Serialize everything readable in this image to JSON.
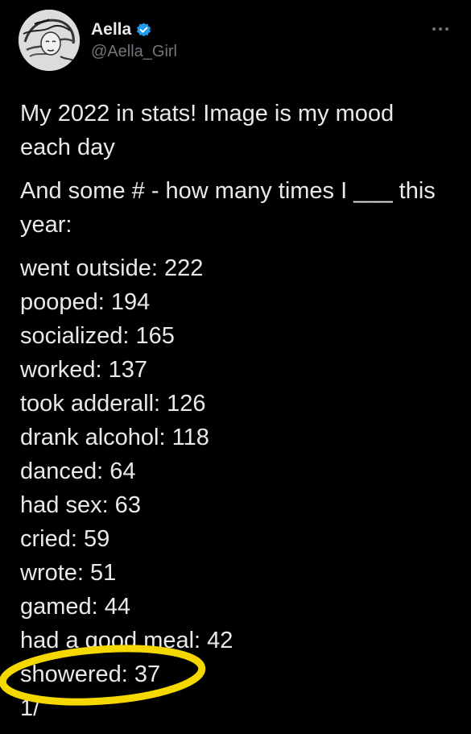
{
  "author": {
    "display_name": "Aella",
    "handle": "@Aella_Girl",
    "verified_icon": "verified-badge-icon",
    "verified_color": "#1d9bf0"
  },
  "more_icon": "more-dots-icon",
  "tweet": {
    "intro": "My 2022 in stats! Image is my mood each day",
    "question": "And some # - how many times I ___ this year:",
    "stats": [
      "went outside: 222",
      "pooped: 194",
      "socialized: 165",
      "worked: 137",
      "took adderall: 126",
      "drank alcohol: 118",
      "danced: 64",
      "had sex: 63",
      "cried: 59",
      "wrote: 51",
      "gamed: 44",
      "had a good meal: 42",
      "showered: 37"
    ],
    "thread_counter": "1/"
  },
  "highlight": {
    "target": "showered: 37",
    "color": "#f5d800"
  },
  "colors": {
    "background": "#000000",
    "text": "#e7e9ea",
    "secondary": "#71767b"
  }
}
